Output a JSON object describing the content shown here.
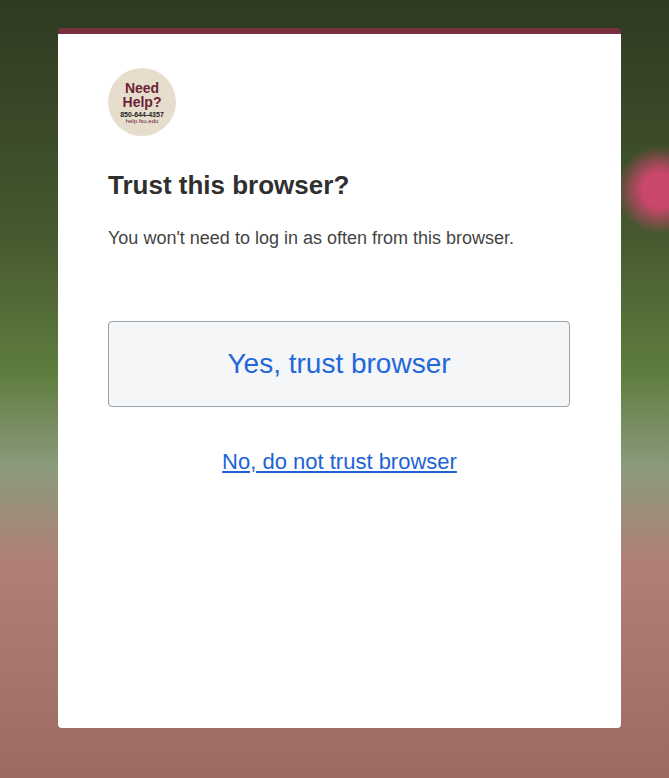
{
  "logo": {
    "lines": [
      "Need",
      "Help?"
    ],
    "phone": "850-644-4357",
    "site": "help.fsu.edu"
  },
  "title": "Trust this browser?",
  "message": "You won't need to log in as often from this browser.",
  "buttons": [
    {
      "label": "Yes, trust browser",
      "kind": "primary"
    },
    {
      "label": "No, do not trust browser",
      "kind": "link"
    }
  ]
}
